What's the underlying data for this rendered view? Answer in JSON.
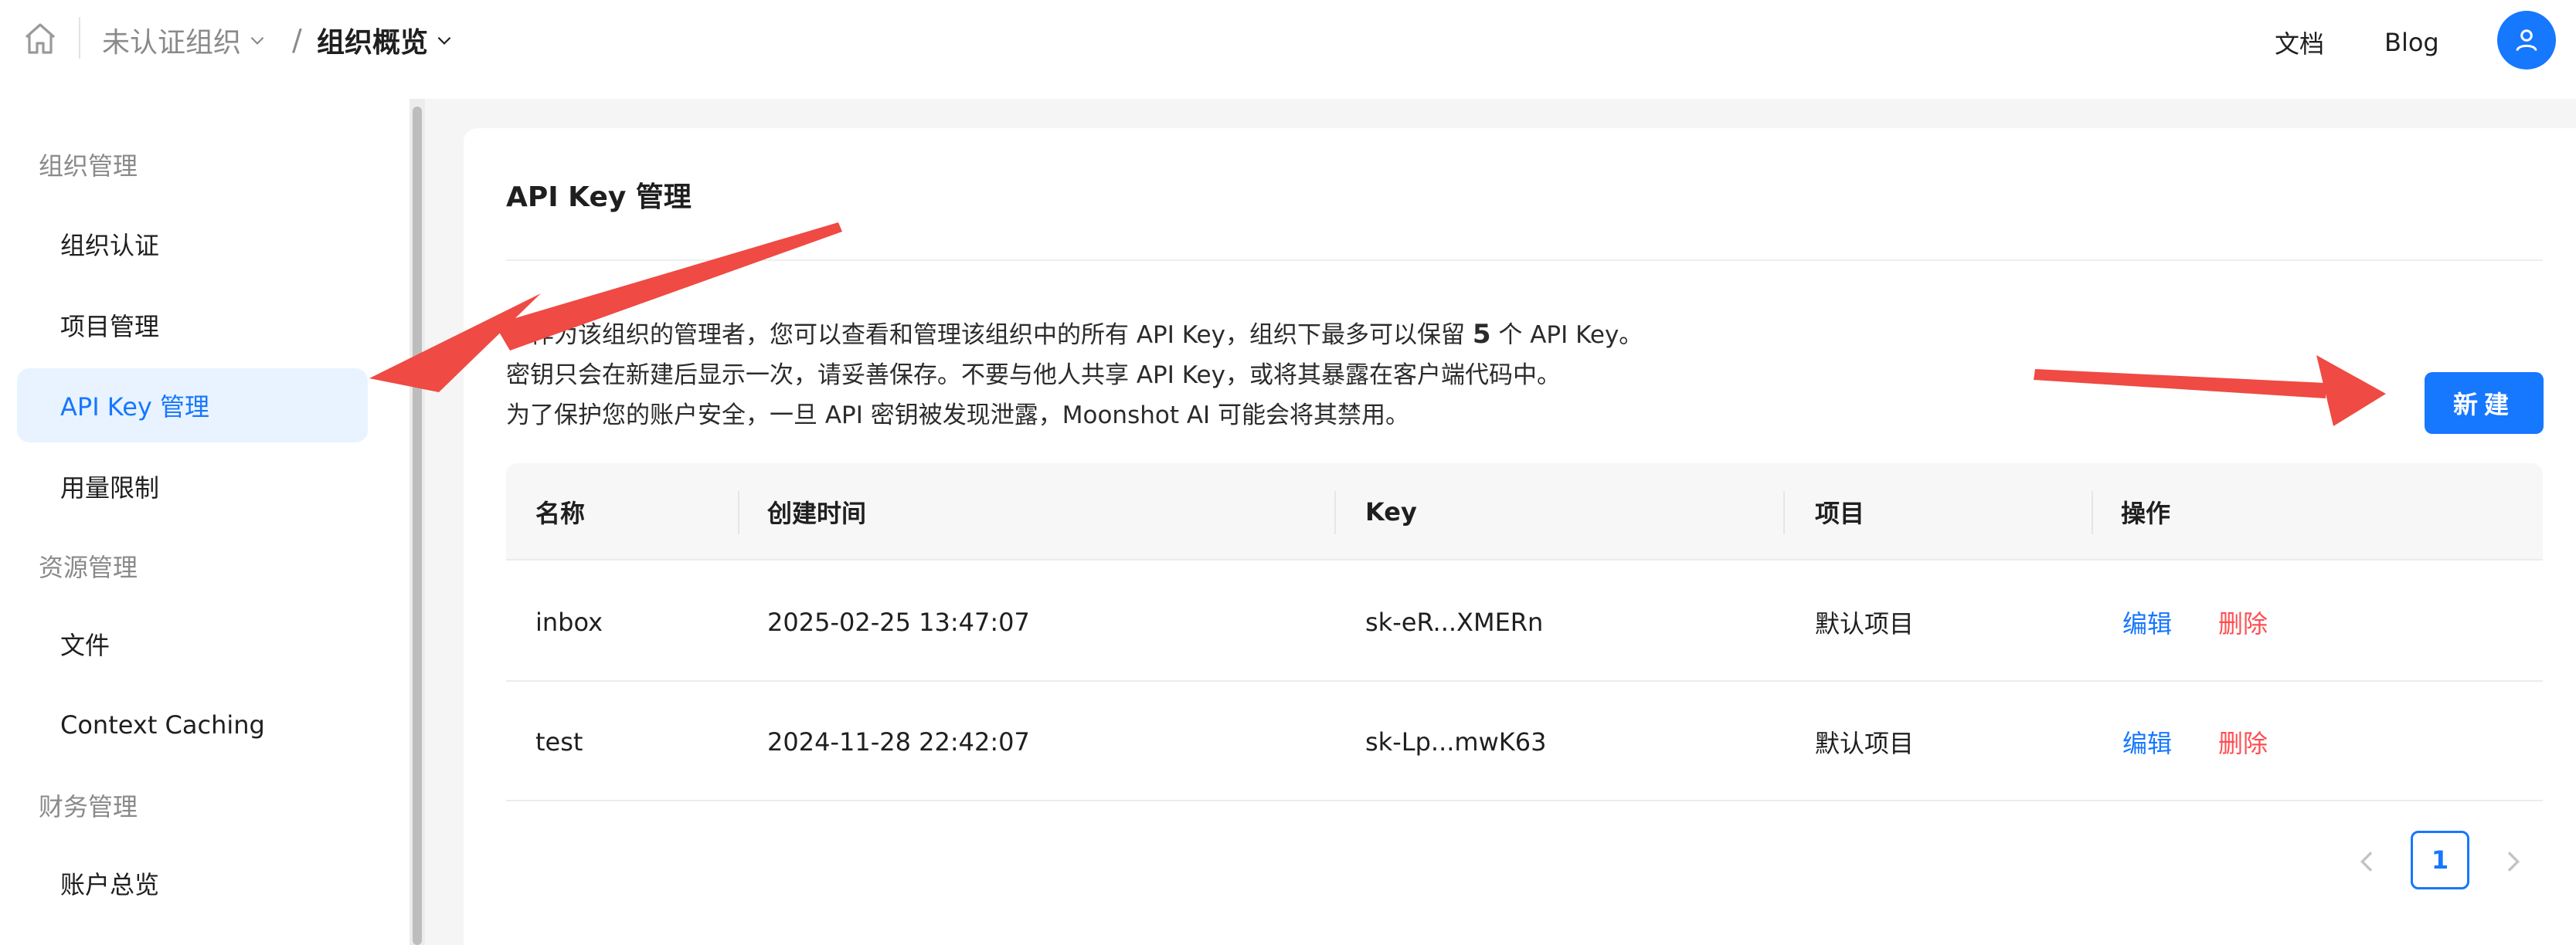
{
  "header": {
    "org_name": "未认证组织",
    "separator": "/",
    "page_name": "组织概览",
    "docs_label": "文档",
    "blog_label": "Blog"
  },
  "sidebar": {
    "groups": [
      {
        "title": "组织管理"
      },
      {
        "title": "资源管理"
      },
      {
        "title": "财务管理"
      }
    ],
    "items": [
      {
        "label": "组织认证"
      },
      {
        "label": "项目管理"
      },
      {
        "label": "API Key 管理"
      },
      {
        "label": "用量限制"
      },
      {
        "label": "文件"
      },
      {
        "label": "Context Caching"
      },
      {
        "label": "账户总览"
      }
    ]
  },
  "main": {
    "title": "API Key 管理",
    "desc_line1_before": "您作为该组织的管理者，您可以查看和管理该组织中的所有 API Key，组织下最多可以保留 ",
    "desc_line1_count": "5",
    "desc_line1_after": " 个 API Key。",
    "desc_line2": "密钥只会在新建后显示一次，请妥善保存。不要与他人共享 API Key，或将其暴露在客户端代码中。",
    "desc_line3": "为了保护您的账户安全，一旦 API 密钥被发现泄露，Moonshot AI 可能会将其禁用。",
    "new_button": "新建"
  },
  "table": {
    "headers": [
      "名称",
      "创建时间",
      "Key",
      "项目",
      "操作"
    ],
    "rows": [
      {
        "name": "inbox",
        "created": "2025-02-25 13:47:07",
        "key": "sk-eR...XMERn",
        "project": "默认项目",
        "edit": "编辑",
        "delete": "删除"
      },
      {
        "name": "test",
        "created": "2024-11-28 22:42:07",
        "key": "sk-Lp...mwK63",
        "project": "默认项目",
        "edit": "编辑",
        "delete": "删除"
      }
    ]
  },
  "pagination": {
    "current": "1"
  },
  "colors": {
    "accent": "#1677ff",
    "danger": "#ff4d4f",
    "annotation_arrow": "#ef4a43"
  }
}
